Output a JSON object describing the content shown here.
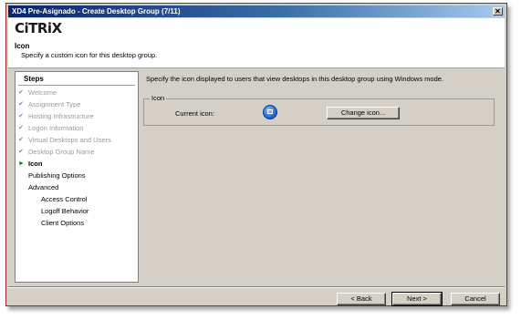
{
  "window": {
    "title": "XD4 Pre-Asignado - Create Desktop Group (7/11)",
    "close_label": "✕"
  },
  "header": {
    "logo": "CiTRiX",
    "title": "Icon",
    "subtitle": "Specify a custom icon for this desktop group."
  },
  "steps": {
    "heading": "Steps",
    "items": [
      {
        "label": "Welcome",
        "state": "done"
      },
      {
        "label": "Assignment Type",
        "state": "done"
      },
      {
        "label": "Hosting Infrastructure",
        "state": "done"
      },
      {
        "label": "Logon Information",
        "state": "done"
      },
      {
        "label": "Virtual Desktops and Users",
        "state": "done"
      },
      {
        "label": "Desktop Group Name",
        "state": "done"
      },
      {
        "label": "Icon",
        "state": "current"
      },
      {
        "label": "Publishing Options",
        "state": "pending"
      },
      {
        "label": "Advanced",
        "state": "pending"
      },
      {
        "label": "Access Control",
        "state": "sub"
      },
      {
        "label": "Logoff Behavior",
        "state": "sub"
      },
      {
        "label": "Client Options",
        "state": "sub"
      }
    ]
  },
  "main": {
    "description": "Specify the icon displayed to users that view desktops in this desktop group using Windows mode.",
    "group_label": "Icon",
    "current_icon_label": "Current icon:",
    "change_icon_button": "Change icon..."
  },
  "footer": {
    "back_button": "< Back",
    "next_button": "Next >",
    "cancel_button": "Cancel"
  },
  "colors": {
    "title_bar": "#0a246a",
    "dialog_bg": "#d4d0c8",
    "window_border": "#8f2a2a"
  }
}
